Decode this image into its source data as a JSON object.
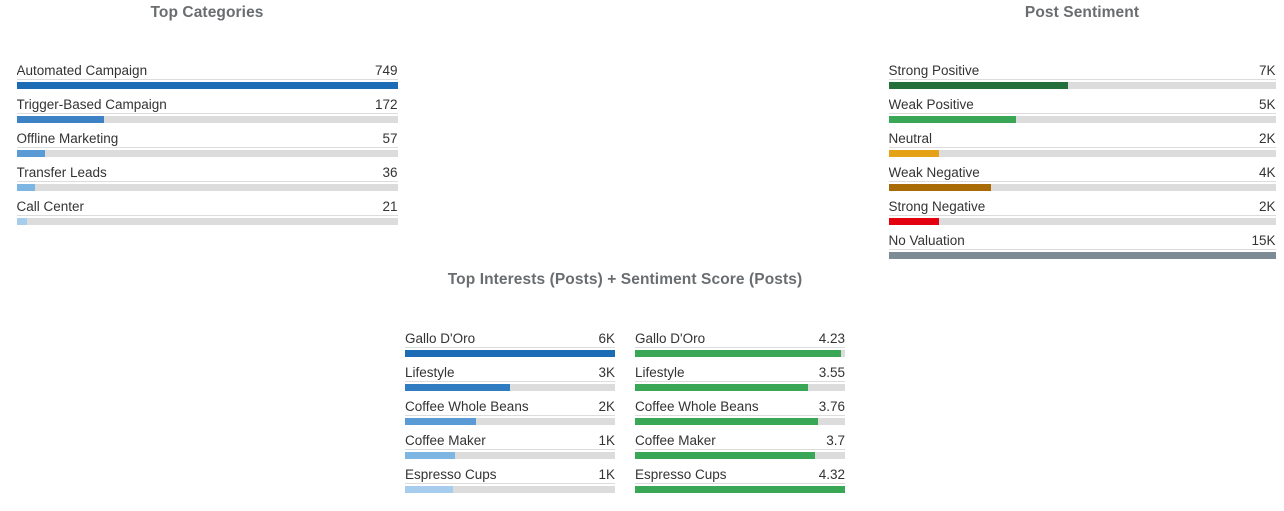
{
  "chart_data": [
    {
      "type": "bar",
      "id": "top-categories",
      "title": "Top Categories",
      "orientation": "horizontal",
      "categories": [
        "Automated Campaign",
        "Trigger-Based Campaign",
        "Offline Marketing",
        "Transfer Leads",
        "Call Center"
      ],
      "values": [
        749,
        172,
        57,
        36,
        21
      ],
      "value_labels": [
        "749",
        "172",
        "57",
        "36",
        "21"
      ],
      "percent_of_max": [
        100,
        22.96,
        7.61,
        4.81,
        2.8
      ],
      "colors": [
        "#1b6cb5",
        "#3c82c4",
        "#5b9bd5",
        "#7db5e3",
        "#a6cdee"
      ],
      "track_color": "#dcdcdc",
      "xlabel": "",
      "ylabel": "",
      "grid": false,
      "legend": "none"
    },
    {
      "type": "bar",
      "id": "post-sentiment",
      "title": "Post Sentiment",
      "orientation": "horizontal",
      "categories": [
        "Strong Positive",
        "Weak Positive",
        "Neutral",
        "Weak Negative",
        "Strong Negative",
        "No Valuation"
      ],
      "values": [
        7000,
        5000,
        2000,
        4000,
        2000,
        15000
      ],
      "value_labels": [
        "7K",
        "5K",
        "2K",
        "4K",
        "2K",
        "15K"
      ],
      "percent_of_max": [
        46.5,
        33.0,
        13.0,
        26.5,
        13.0,
        100
      ],
      "colors": [
        "#256f3a",
        "#3aa757",
        "#e5a216",
        "#a96b05",
        "#e3000f",
        "#7d8b94"
      ],
      "track_color": "#dcdcdc",
      "xlabel": "",
      "ylabel": "",
      "grid": false,
      "legend": "none"
    },
    {
      "type": "bar",
      "id": "top-interests-posts",
      "title": "Top Interests (Posts)",
      "orientation": "horizontal",
      "categories": [
        "Gallo D'Oro",
        "Lifestyle",
        "Coffee Whole Beans",
        "Coffee Maker",
        "Espresso Cups"
      ],
      "values": [
        6000,
        3000,
        2000,
        1000,
        1000
      ],
      "value_labels": [
        "6K",
        "3K",
        "2K",
        "1K",
        "1K"
      ],
      "percent_of_max": [
        100,
        50,
        34,
        24,
        23
      ],
      "colors": [
        "#1b6cb5",
        "#2f7cc0",
        "#5b9bd5",
        "#7db5e3",
        "#a6cdee"
      ],
      "track_color": "#dcdcdc",
      "grid": false,
      "legend": "none"
    },
    {
      "type": "bar",
      "id": "sentiment-score-posts",
      "title": "Sentiment Score (Posts)",
      "orientation": "horizontal",
      "categories": [
        "Gallo D'Oro",
        "Lifestyle",
        "Coffee Whole Beans",
        "Coffee Maker",
        "Espresso Cups"
      ],
      "values": [
        4.23,
        3.55,
        3.76,
        3.7,
        4.32
      ],
      "value_labels": [
        "4.23",
        "3.55",
        "3.76",
        "3.7",
        "4.32"
      ],
      "percent_of_max": [
        97.9,
        82.2,
        87.0,
        85.6,
        100
      ],
      "colors": [
        "#3ba košt"
      ],
      "bar_color": "#3aa757",
      "track_color": "#dcdcdc",
      "grid": false,
      "legend": "none"
    }
  ],
  "panels": {
    "top_categories": {
      "title": "Top Categories",
      "rows": [
        {
          "label": "Automated Campaign",
          "value": "749",
          "pct": 100,
          "color": "#1b6cb5"
        },
        {
          "label": "Trigger-Based Campaign",
          "value": "172",
          "pct": 22.96,
          "color": "#3c82c4"
        },
        {
          "label": "Offline Marketing",
          "value": "57",
          "pct": 7.61,
          "color": "#5b9bd5"
        },
        {
          "label": "Transfer Leads",
          "value": "36",
          "pct": 4.81,
          "color": "#7db5e3"
        },
        {
          "label": "Call Center",
          "value": "21",
          "pct": 2.8,
          "color": "#a6cdee"
        }
      ]
    },
    "post_sentiment": {
      "title": "Post Sentiment",
      "rows": [
        {
          "label": "Strong Positive",
          "value": "7K",
          "pct": 46.5,
          "color": "#256f3a"
        },
        {
          "label": "Weak Positive",
          "value": "5K",
          "pct": 33.0,
          "color": "#3aa757"
        },
        {
          "label": "Neutral",
          "value": "2K",
          "pct": 13.0,
          "color": "#e5a216"
        },
        {
          "label": "Weak Negative",
          "value": "4K",
          "pct": 26.5,
          "color": "#a96b05"
        },
        {
          "label": "Strong Negative",
          "value": "2K",
          "pct": 13.0,
          "color": "#e3000f"
        },
        {
          "label": "No Valuation",
          "value": "15K",
          "pct": 100,
          "color": "#7d8b94"
        }
      ]
    },
    "interests": {
      "title": "Top Interests (Posts) + Sentiment Score (Posts)",
      "left_rows": [
        {
          "label": "Gallo D'Oro",
          "value": "6K",
          "pct": 100,
          "color": "#1b6cb5"
        },
        {
          "label": "Lifestyle",
          "value": "3K",
          "pct": 50,
          "color": "#2f7cc0"
        },
        {
          "label": "Coffee Whole Beans",
          "value": "2K",
          "pct": 34,
          "color": "#5b9bd5"
        },
        {
          "label": "Coffee Maker",
          "value": "1K",
          "pct": 24,
          "color": "#7db5e3"
        },
        {
          "label": "Espresso Cups",
          "value": "1K",
          "pct": 23,
          "color": "#a6cdee"
        }
      ],
      "right_rows": [
        {
          "label": "Gallo D'Oro",
          "value": "4.23",
          "pct": 97.9,
          "color": "#3aa757"
        },
        {
          "label": "Lifestyle",
          "value": "3.55",
          "pct": 82.2,
          "color": "#3aa757"
        },
        {
          "label": "Coffee Whole Beans",
          "value": "3.76",
          "pct": 87.0,
          "color": "#3aa757"
        },
        {
          "label": "Coffee Maker",
          "value": "3.7",
          "pct": 85.6,
          "color": "#3aa757"
        },
        {
          "label": "Espresso Cups",
          "value": "4.32",
          "pct": 100,
          "color": "#3aa757"
        }
      ]
    }
  }
}
